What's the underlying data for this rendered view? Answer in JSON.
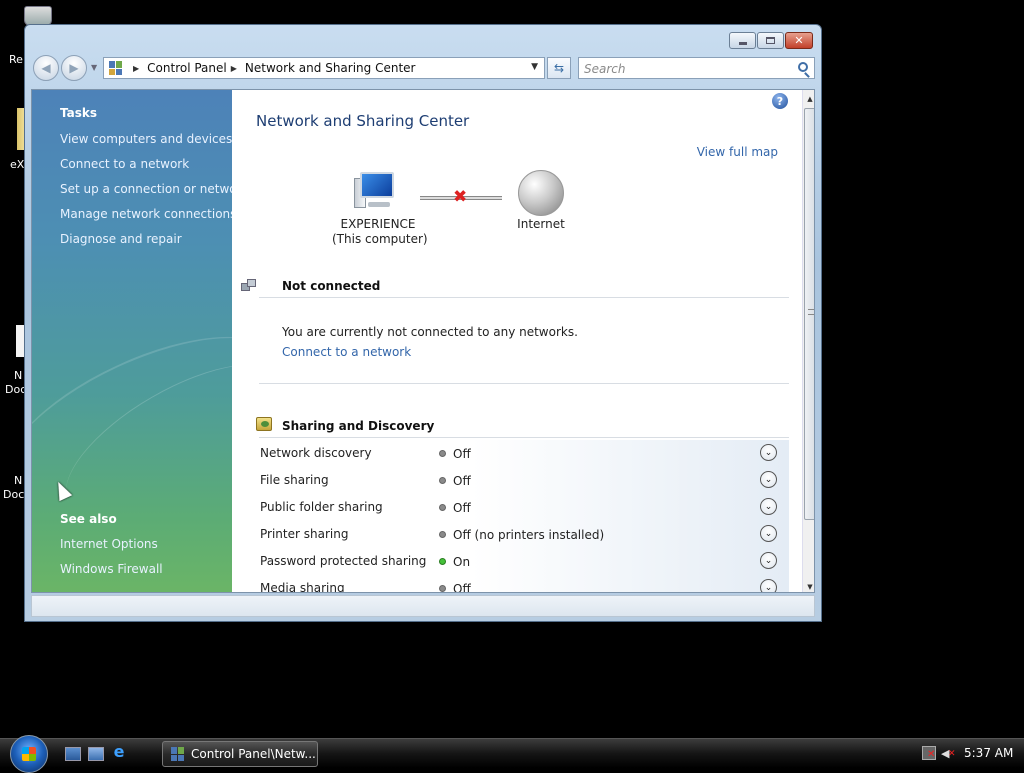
{
  "desktop": {
    "icon_labels": [
      "Re",
      "eX",
      "N",
      "Doc",
      "N",
      "Doc"
    ]
  },
  "window": {
    "title_buttons": {
      "minimize": "minimize",
      "maximize": "maximize",
      "close": "close"
    },
    "address": {
      "crumbs": [
        "Control Panel",
        "Network and Sharing Center"
      ]
    },
    "search": {
      "placeholder": "Search"
    }
  },
  "sidebar": {
    "tasks_heading": "Tasks",
    "tasks": [
      "View computers and devices",
      "Connect to a network",
      "Set up a connection or network",
      "Manage network connections",
      "Diagnose and repair"
    ],
    "see_also_heading": "See also",
    "see_also": [
      "Internet Options",
      "Windows Firewall"
    ]
  },
  "main": {
    "title": "Network and Sharing Center",
    "view_full_map": "View full map",
    "map": {
      "computer_name": "EXPERIENCE",
      "computer_sub": "(This computer)",
      "internet_label": "Internet"
    },
    "connection": {
      "heading": "Not connected",
      "message": "You are currently not connected to any networks.",
      "link": "Connect to a network"
    },
    "sharing": {
      "heading": "Sharing and Discovery",
      "rows": [
        {
          "label": "Network discovery",
          "status": "Off",
          "on": false
        },
        {
          "label": "File sharing",
          "status": "Off",
          "on": false
        },
        {
          "label": "Public folder sharing",
          "status": "Off",
          "on": false
        },
        {
          "label": "Printer sharing",
          "status": "Off (no printers installed)",
          "on": false
        },
        {
          "label": "Password protected sharing",
          "status": "On",
          "on": true
        },
        {
          "label": "Media sharing",
          "status": "Off",
          "on": false
        }
      ]
    }
  },
  "taskbar": {
    "task_button": "Control Panel\\Netw...",
    "clock": "5:37 AM"
  }
}
